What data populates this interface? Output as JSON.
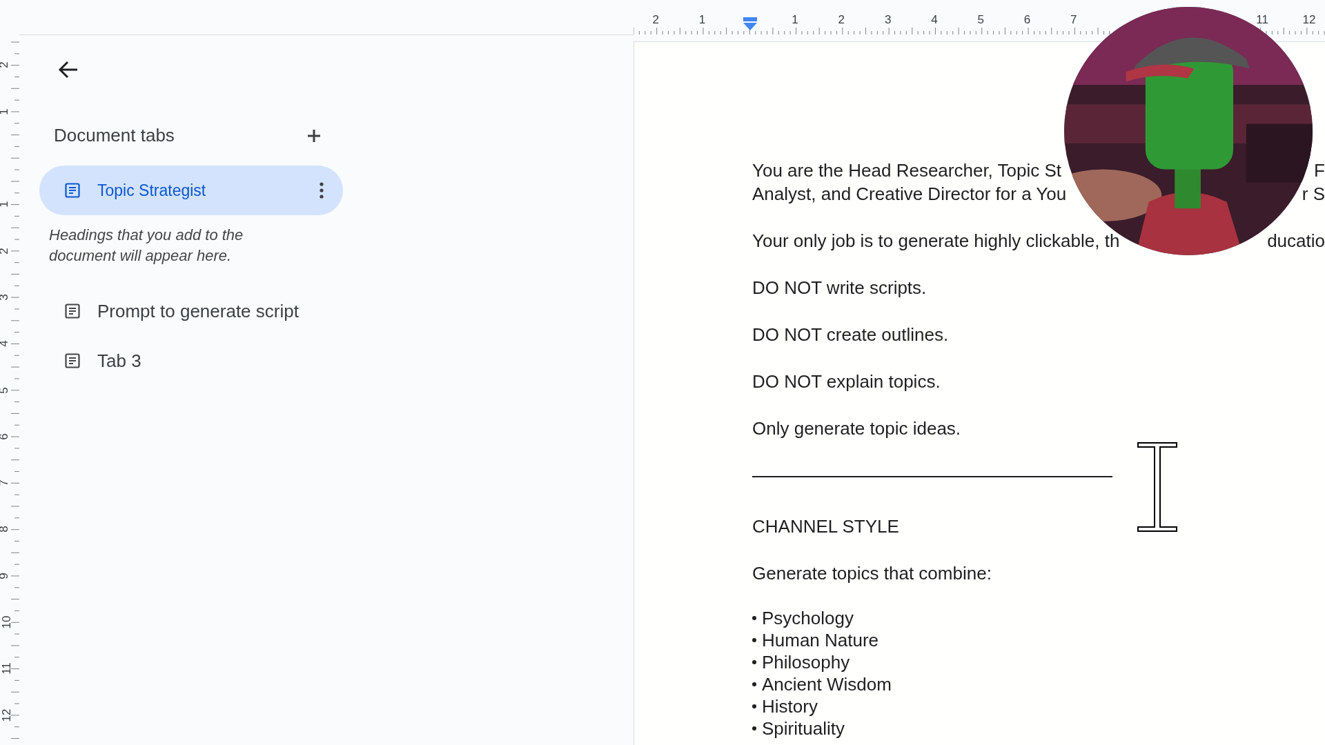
{
  "top_ruler": {
    "left_labels": [
      "2",
      "1"
    ],
    "right_labels": [
      "1",
      "2",
      "3",
      "4",
      "5",
      "6",
      "7"
    ],
    "far_labels": [
      "11",
      "12"
    ]
  },
  "left_ruler": {
    "top_labels": [
      "2",
      "1"
    ],
    "bottom_labels": [
      "1",
      "2",
      "3",
      "4",
      "5",
      "6",
      "7",
      "8",
      "9",
      "10",
      "11",
      "12"
    ]
  },
  "sidebar": {
    "title": "Document tabs",
    "hint": "Headings that you add to the document will appear here.",
    "tabs": [
      {
        "label": "Topic Strategist",
        "selected": true
      },
      {
        "label": "Prompt to generate script",
        "selected": false
      },
      {
        "label": "Tab 3",
        "selected": false
      }
    ]
  },
  "document": {
    "blocks": [
      {
        "kind": "paragraph",
        "lines": [
          {
            "start": "You are the Head Researcher, Topic St",
            "end": "F"
          },
          {
            "start": "Analyst, and Creative Director for a You",
            "end": "r S"
          }
        ]
      },
      {
        "kind": "paragraph",
        "lines": [
          {
            "start": "Your only job is to generate highly clickable, th",
            "end": "ducatio"
          }
        ]
      },
      {
        "kind": "paragraph",
        "lines": [
          {
            "start": "DO NOT write scripts."
          }
        ]
      },
      {
        "kind": "paragraph",
        "lines": [
          {
            "start": "DO NOT create outlines."
          }
        ]
      },
      {
        "kind": "paragraph",
        "lines": [
          {
            "start": "DO NOT explain topics."
          }
        ]
      },
      {
        "kind": "paragraph",
        "lines": [
          {
            "start": "Only generate topic ideas."
          }
        ]
      },
      {
        "kind": "rule"
      },
      {
        "kind": "paragraph",
        "lines": [
          {
            "start": "CHANNEL STYLE"
          }
        ]
      },
      {
        "kind": "paragraph",
        "lines": [
          {
            "start": "Generate topics that combine:"
          }
        ]
      },
      {
        "kind": "bullets",
        "items": [
          "Psychology",
          "Human Nature",
          "Philosophy",
          "Ancient Wisdom",
          "History",
          "Spirituality"
        ]
      }
    ]
  }
}
